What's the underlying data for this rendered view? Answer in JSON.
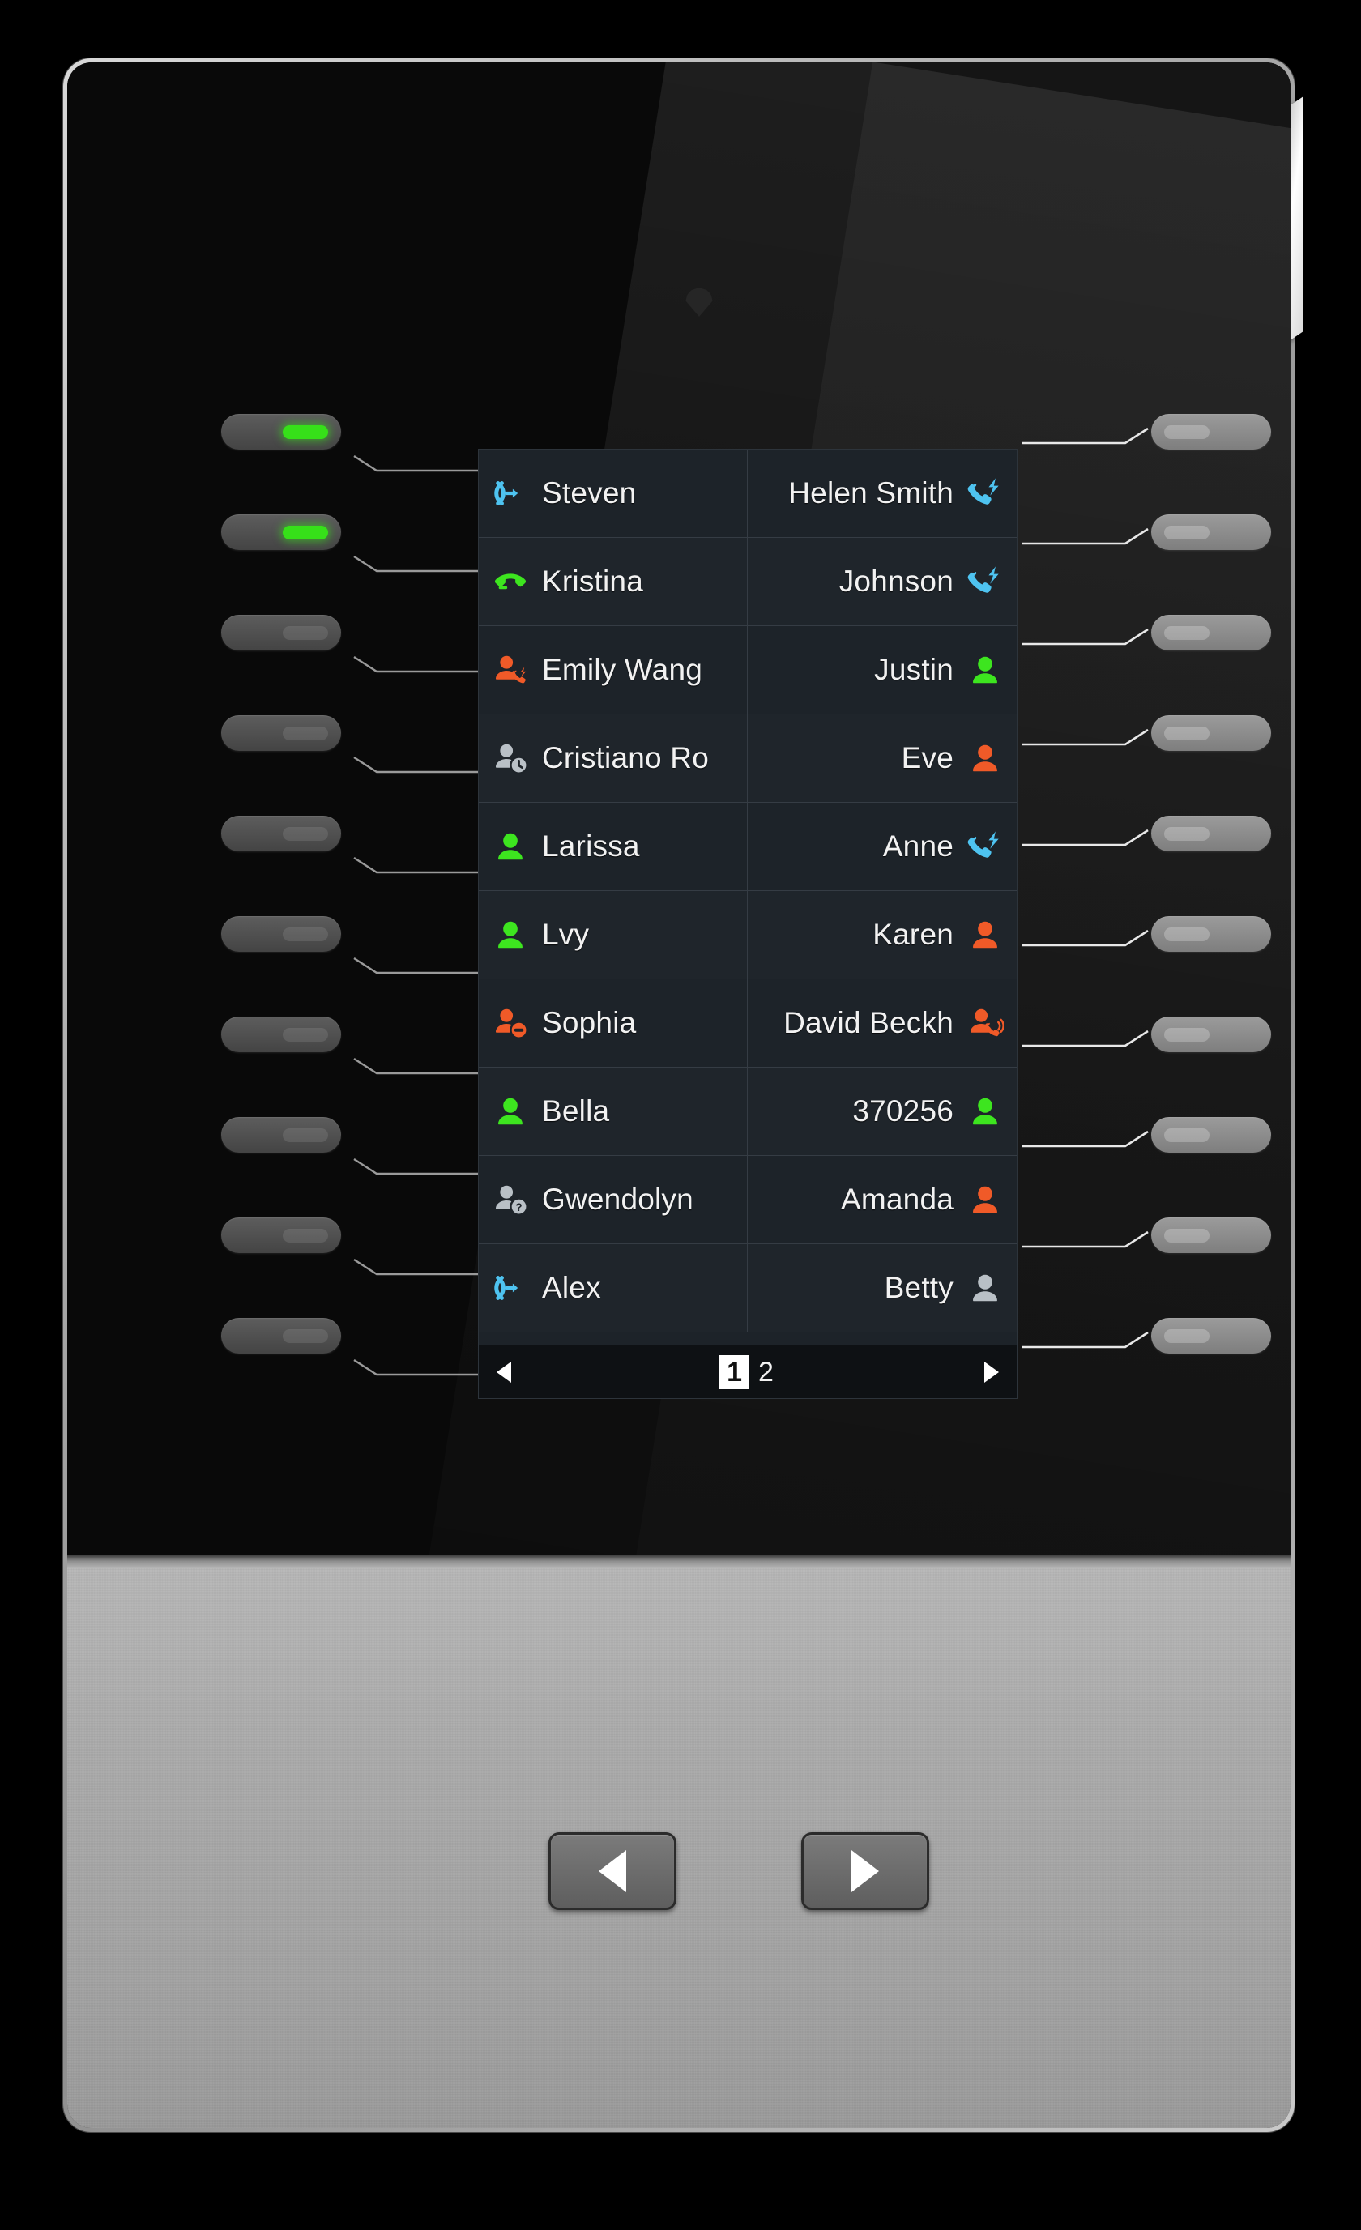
{
  "device": {
    "name": "LCD expansion module",
    "sensor_label": "sensor-dot"
  },
  "lcd": {
    "rows": [
      {
        "left": {
          "label": "Steven",
          "icon": "call-transfer-blue"
        },
        "right": {
          "label": "Helen Smith",
          "icon": "handset-ring-blue"
        }
      },
      {
        "left": {
          "label": "Kristina",
          "icon": "handset-hold-green"
        },
        "right": {
          "label": "Johnson",
          "icon": "handset-ring-blue"
        }
      },
      {
        "left": {
          "label": "Emily Wang",
          "icon": "user-phone-orange"
        },
        "right": {
          "label": "Justin",
          "icon": "user-green"
        }
      },
      {
        "left": {
          "label": "Cristiano Ro",
          "icon": "user-clock-gray"
        },
        "right": {
          "label": "Eve",
          "icon": "user-orange"
        }
      },
      {
        "left": {
          "label": "Larissa",
          "icon": "user-green"
        },
        "right": {
          "label": "Anne",
          "icon": "handset-ring-blue"
        }
      },
      {
        "left": {
          "label": "Lvy",
          "icon": "user-green"
        },
        "right": {
          "label": "Karen",
          "icon": "user-orange"
        }
      },
      {
        "left": {
          "label": "Sophia",
          "icon": "user-dnd-orange"
        },
        "right": {
          "label": "David Beckh",
          "icon": "user-ringing-orange"
        }
      },
      {
        "left": {
          "label": "Bella",
          "icon": "user-green"
        },
        "right": {
          "label": "370256",
          "icon": "user-green"
        }
      },
      {
        "left": {
          "label": "Gwendolyn",
          "icon": "user-unknown-gray"
        },
        "right": {
          "label": "Amanda",
          "icon": "user-orange"
        }
      },
      {
        "left": {
          "label": "Alex",
          "icon": "call-transfer-blue"
        },
        "right": {
          "label": "Betty",
          "icon": "user-gray"
        }
      }
    ],
    "pagination": {
      "prev_label": "prev-page-arrow",
      "next_label": "next-page-arrow",
      "pages": [
        "1",
        "2"
      ],
      "active_page": "1"
    }
  },
  "keys": {
    "left": [
      {
        "led": "on"
      },
      {
        "led": "on"
      },
      {
        "led": "off"
      },
      {
        "led": "off"
      },
      {
        "led": "off"
      },
      {
        "led": "off"
      },
      {
        "led": "off"
      },
      {
        "led": "off"
      },
      {
        "led": "off"
      },
      {
        "led": "off"
      }
    ],
    "right": [
      {
        "led": "off"
      },
      {
        "led": "off"
      },
      {
        "led": "off"
      },
      {
        "led": "off"
      },
      {
        "led": "off"
      },
      {
        "led": "off"
      },
      {
        "led": "off"
      },
      {
        "led": "off"
      },
      {
        "led": "off"
      },
      {
        "led": "off"
      }
    ]
  },
  "nav": {
    "prev_label": "page-left-button",
    "next_label": "page-right-button"
  },
  "colors": {
    "led_green": "#36e019",
    "icon_green": "#3de51f",
    "icon_orange": "#f05a28",
    "icon_blue": "#4ec3f0",
    "icon_gray": "#b9c0c6",
    "lcd_bg": "#1d2329",
    "text": "#f2f2f2"
  }
}
